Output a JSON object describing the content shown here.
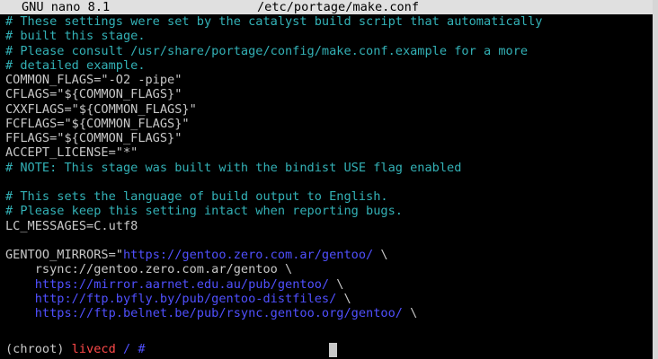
{
  "nano": {
    "app": "GNU nano 8.1",
    "file": "/etc/portage/make.conf"
  },
  "colors": {
    "comment": "#33b1b6",
    "url": "#5050ff",
    "plain": "#c8c8c8",
    "host": "#ff4a4a",
    "titlebar_bg": "#e0e0e0"
  },
  "lines": [
    {
      "type": "comment",
      "text": "# These settings were set by the catalyst build script that automatically"
    },
    {
      "type": "comment",
      "text": "# built this stage."
    },
    {
      "type": "comment",
      "text": "# Please consult /usr/share/portage/config/make.conf.example for a more"
    },
    {
      "type": "comment",
      "text": "# detailed example."
    },
    {
      "type": "plain",
      "text": "COMMON_FLAGS=\"-O2 -pipe\""
    },
    {
      "type": "plain",
      "text": "CFLAGS=\"${COMMON_FLAGS}\""
    },
    {
      "type": "plain",
      "text": "CXXFLAGS=\"${COMMON_FLAGS}\""
    },
    {
      "type": "plain",
      "text": "FCFLAGS=\"${COMMON_FLAGS}\""
    },
    {
      "type": "plain",
      "text": "FFLAGS=\"${COMMON_FLAGS}\""
    },
    {
      "type": "plain",
      "text": "ACCEPT_LICENSE=\"*\""
    },
    {
      "type": "comment",
      "text": "# NOTE: This stage was built with the bindist USE flag enabled"
    },
    {
      "type": "blank",
      "text": ""
    },
    {
      "type": "comment",
      "text": "# This sets the language of build output to English."
    },
    {
      "type": "comment",
      "text": "# Please keep this setting intact when reporting bugs."
    },
    {
      "type": "plain",
      "text": "LC_MESSAGES=C.utf8"
    },
    {
      "type": "blank",
      "text": ""
    },
    {
      "type": "mirror",
      "prefix": "GENTOO_MIRRORS=\"",
      "url": "https://gentoo.zero.com.ar/gentoo/",
      "suffix": " \\"
    },
    {
      "type": "mirror",
      "prefix": "    ",
      "plain": "rsync://gentoo.zero.com.ar/gentoo",
      "suffix": " \\"
    },
    {
      "type": "mirror",
      "prefix": "    ",
      "url": "https://mirror.aarnet.edu.au/pub/gentoo/",
      "suffix": " \\"
    },
    {
      "type": "mirror",
      "prefix": "    ",
      "url": "http://ftp.byfly.by/pub/gentoo-distfiles/",
      "suffix": " \\"
    },
    {
      "type": "mirror",
      "prefix": "    ",
      "url": "https://ftp.belnet.be/pub/rsync.gentoo.org/gentoo/",
      "suffix": " \\"
    }
  ],
  "shell": {
    "chroot": "(chroot) ",
    "host": "livecd",
    "sep": " ",
    "dir": "/",
    "symbol": " # "
  }
}
